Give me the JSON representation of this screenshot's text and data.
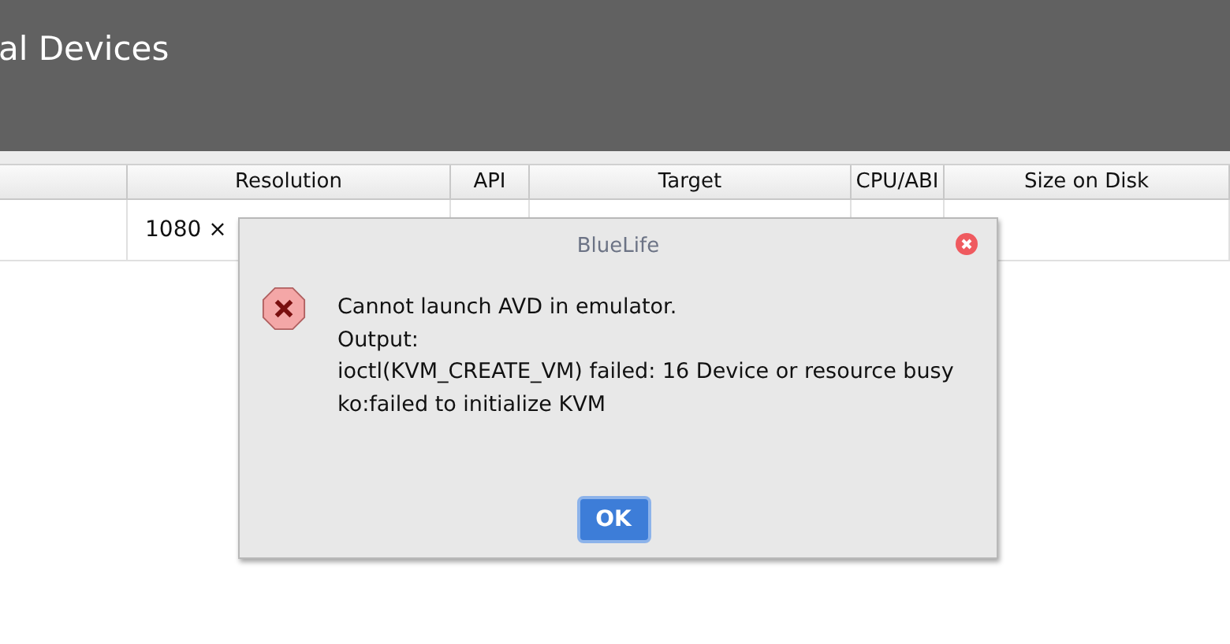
{
  "header": {
    "title": "al Devices"
  },
  "table": {
    "columns": [
      "",
      "Resolution",
      "API",
      "Target",
      "CPU/ABI",
      "Size on Disk"
    ],
    "rows": [
      {
        "cells": [
          "",
          "1080 ×",
          "",
          "",
          "",
          ""
        ]
      }
    ]
  },
  "dialog": {
    "title": "BlueLife",
    "lines": [
      "Cannot launch AVD in emulator.",
      "Output:",
      "ioctl(KVM_CREATE_VM) failed: 16 Device or resource busy",
      "ko:failed to initialize KVM"
    ],
    "buttons": [
      "OK"
    ]
  }
}
